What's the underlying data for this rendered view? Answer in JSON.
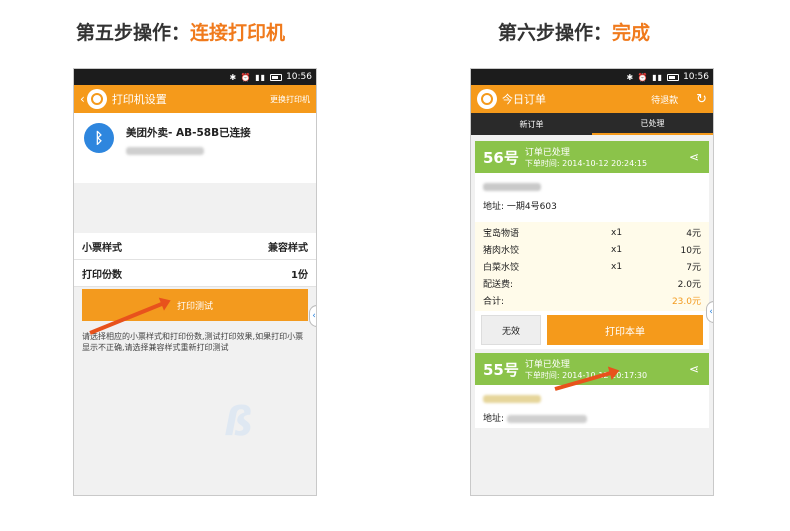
{
  "step5": {
    "prefix": "第五步操作：",
    "highlight": "连接打印机"
  },
  "step6": {
    "prefix": "第六步操作：",
    "highlight": "完成"
  },
  "status_bar": {
    "time": "10:56",
    "icons": "✱ ⏰ ▮▮"
  },
  "left_phone": {
    "appbar": {
      "title": "打印机设置",
      "right_action": "更换打印机"
    },
    "device": {
      "icon": "bluetooth-icon",
      "name": "美团外卖- AB-58B已连接"
    },
    "settings": [
      {
        "label": "小票样式",
        "value": "兼容样式"
      },
      {
        "label": "打印份数",
        "value": "1份"
      }
    ],
    "print_test_label": "打印测试",
    "hint": "请选择相应的小票样式和打印份数,测试打印效果,如果打印小票显示不正确,请选择兼容样式重新打印测试"
  },
  "right_phone": {
    "appbar": {
      "title": "今日订单",
      "right_action": "待退款"
    },
    "tabs": [
      "新订单",
      "已处理"
    ],
    "order56": {
      "number": "56号",
      "status": "订单已处理",
      "time": "下单时间: 2014-10-12 20:24:15",
      "address": "地址: 一期4号603",
      "items": [
        {
          "name": "宝岛物语",
          "qty": "x1",
          "price": "4元"
        },
        {
          "name": "猪肉水饺",
          "qty": "x1",
          "price": "10元"
        },
        {
          "name": "白菜水饺",
          "qty": "x1",
          "price": "7元"
        }
      ],
      "delivery_label": "配送费:",
      "delivery_price": "2.0元",
      "total_label": "合计:",
      "total_price": "23.0元",
      "void_label": "无效",
      "print_label": "打印本单"
    },
    "order55": {
      "number": "55号",
      "status": "订单已处理",
      "time": "下单时间: 2014-10-12 20:17:30",
      "address": "地址:"
    }
  },
  "colors": {
    "accent": "#f59a1b",
    "green": "#8bc34a",
    "arrow": "#e8521c",
    "bluetooth": "#2e86de"
  }
}
